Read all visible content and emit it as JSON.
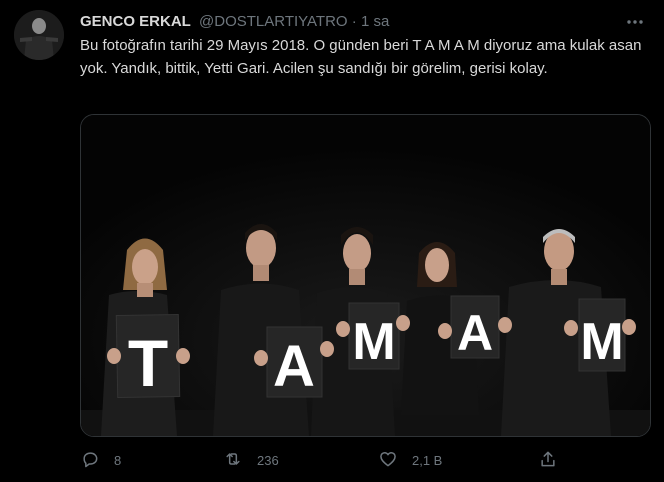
{
  "author": {
    "name": "GENCO ERKAL",
    "handle": "@DOSTLARTIYATRO",
    "separator": "·",
    "time": "1 sa"
  },
  "more_icon": "more-horizontal-icon",
  "tweet_text": "Bu fotoğrafın tarihi 29 Mayıs 2018. O günden beri T A M A M diyoruz ama kulak asan yok. Yandık, bittik, Yetti Gari. Acilen şu sandığı bir görelim, gerisi kolay.",
  "photo": {
    "signs": [
      "T",
      "A",
      "M",
      "A",
      "M"
    ]
  },
  "actions": {
    "reply": {
      "icon": "reply-icon",
      "count": "8"
    },
    "retweet": {
      "icon": "retweet-icon",
      "count": "236"
    },
    "like": {
      "icon": "heart-icon",
      "count": "2,1 B"
    },
    "share": {
      "icon": "share-icon"
    }
  },
  "colors": {
    "background": "#000000",
    "text": "#d9d9d9",
    "secondary": "#6e767d",
    "border": "#2f3336"
  }
}
